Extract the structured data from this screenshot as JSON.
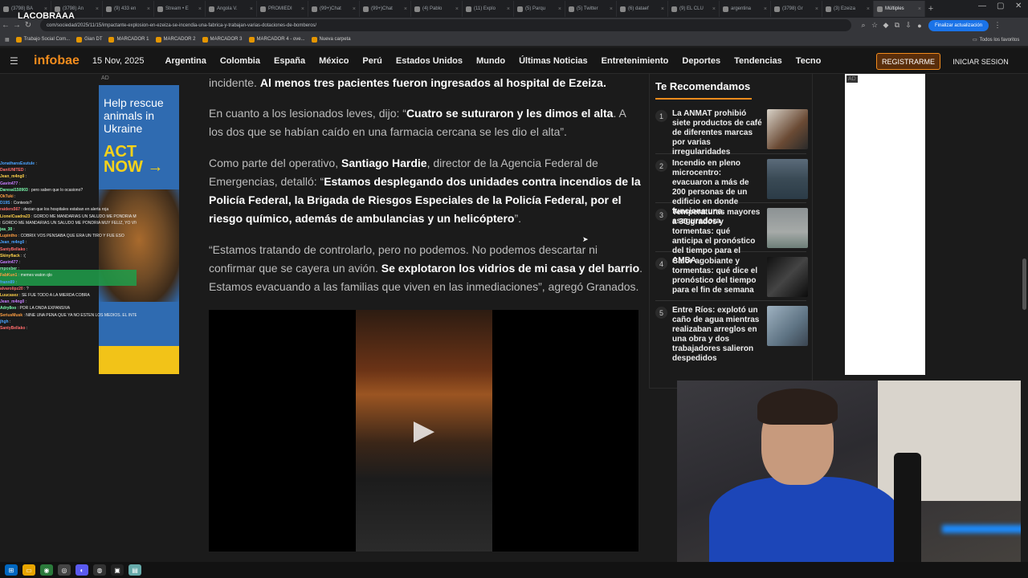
{
  "browser": {
    "tabs": [
      {
        "label": "(3798) BA"
      },
      {
        "label": "(3798) An"
      },
      {
        "label": "(9) 433 en"
      },
      {
        "label": "Stream • E"
      },
      {
        "label": "Angola V."
      },
      {
        "label": "PROMIEDI"
      },
      {
        "label": "(99+)Chat"
      },
      {
        "label": "(99+)Chat"
      },
      {
        "label": "(4) Pablo"
      },
      {
        "label": "(11) Explo"
      },
      {
        "label": "(5) Parqu"
      },
      {
        "label": "(5) Twitter"
      },
      {
        "label": "(6) dataef"
      },
      {
        "label": "(9) EL CLU"
      },
      {
        "label": "argentina"
      },
      {
        "label": "(3798) Gr"
      },
      {
        "label": "(3) Ezeiza"
      },
      {
        "label": "Múltiples"
      }
    ],
    "url": "com/sociedad/2025/11/15/impactante-explosion-en-ezeiza-se-incendia-una-fabrica-y-trabajan-varias-dotaciones-de-bomberos/",
    "update_label": "Finalizar actualización",
    "bookmarks": [
      "Trabajo Social Com...",
      "Gian DT",
      "MARCADOR 1",
      "MARCADOR 2",
      "MARCADOR 3",
      "MARCADOR 4 - ove...",
      "Nueva carpeta"
    ],
    "bookmarks_right": "Todos los favoritos"
  },
  "overlay": {
    "logo": "LACOBRAAA"
  },
  "site": {
    "logo": "infobae",
    "date": "15 Nov, 2025",
    "nav": [
      "Argentina",
      "Colombia",
      "España",
      "México",
      "Perú",
      "Estados Unidos",
      "Mundo",
      "Últimas Noticias",
      "Entretenimiento",
      "Deportes",
      "Tendencias",
      "Tecno"
    ],
    "register": "REGISTRARME",
    "login": "INICIAR SESION"
  },
  "ad_left": {
    "label": "AD",
    "line1": "Help rescue animals in Ukraine",
    "line2": "ACT NOW →"
  },
  "ad_right": {
    "label": "AD"
  },
  "article": {
    "p1_pre": "incidente. ",
    "p1_bold": "Al menos tres pacientes fueron ingresados al hospital de Ezeiza.",
    "p2_pre": "En cuanto a los lesionados leves, dijo: “",
    "p2_bold": "Cuatro se suturaron y les dimos el alta",
    "p2_post": ". A los dos que se habían caído en una farmacia cercana se les dio el alta”.",
    "p3_pre": "Como parte del operativo, ",
    "p3_bold1": "Santiago Hardie",
    "p3_mid": ", director de la Agencia Federal de Emergencias, detalló: “",
    "p3_bold2": "Estamos desplegando dos unidades contra incendios de la Policía Federal, la Brigada de Riesgos Especiales de la Policía Federal, por el riesgo químico, además de ambulancias y un helicóptero",
    "p3_post": "”.",
    "p4_pre": "“Estamos tratando de controlarlo, pero no podemos. No podemos descartar ni confirmar que se cayera un avión. ",
    "p4_bold": "Se explotaron los vidrios de mi casa y del barrio",
    "p4_post": ". Estamos evacuando a las familias que viven en las inmediaciones”, agregó Granados."
  },
  "recommend": {
    "title": "Te Recomendamos",
    "items": [
      {
        "num": "1",
        "text": "La ANMAT prohibió siete productos de café de diferentes marcas por varias irregularidades"
      },
      {
        "num": "2",
        "text": "Incendio en pleno microcentro: evacuaron a más de 200 personas de un edificio en donde funciona una aseguradora"
      },
      {
        "num": "3",
        "text": "Temperaturas mayores a 30 grados y tormentas: qué anticipa el pronóstico del tiempo para el AMBA"
      },
      {
        "num": "4",
        "text": "Calor agobiante y tormentas: qué dice el pronóstico del tiempo para el fin de semana"
      },
      {
        "num": "5",
        "text": "Entre Ríos: explotó un caño de agua mientras realizaban arreglos en una obra y dos trabajadores salieron despedidos"
      }
    ]
  },
  "chat": [
    {
      "user": "JonathansEsutule",
      "msg": ""
    },
    {
      "user": "DaniUNITED",
      "msg": ""
    },
    {
      "user": "Jean_m4ng0",
      "msg": ""
    },
    {
      "user": "Gavin477",
      "msg": ""
    },
    {
      "user": "Daresal150903",
      "msg": "pero saben que lo ocasiono?"
    },
    {
      "user": "OkTuki",
      "msg": ""
    },
    {
      "user": "D19S",
      "msg": "Contexto?"
    },
    {
      "user": "raiders567",
      "msg": "decian que los hospitales estaban en alerta roja"
    },
    {
      "user": "LionelCuadra23",
      "msg": "GORDO ME MANDARIAS UN SALUDO ME PONDRIA MUY FELIZ, YO VIVO EN SAN VICENTE Y TENGO MIEDO"
    },
    {
      "user": "",
      "msg": "GORDO ME MANDARIAS UN SALUDO ME PONDRIA MUY FELIZ, YO VIVO EN SAN VICENTE Y TENGO MIEDO"
    },
    {
      "user": "jea_30",
      "msg": ""
    },
    {
      "user": "Lupintho",
      "msg": "COBRIX VOS PENSABA QUE ERA UN TIRO Y FUE ESO"
    },
    {
      "user": "Jean_m4ng0",
      "msg": ""
    },
    {
      "user": "SantyBellako",
      "msg": ""
    },
    {
      "user": "Skinyflack",
      "msg": ":("
    },
    {
      "user": "Gavin477",
      "msg": ""
    },
    {
      "user": "mposber",
      "msg": ""
    },
    {
      "user": "FabKun1",
      "msg": "memes waton qlo"
    },
    {
      "user": "frann89",
      "msg": ""
    },
    {
      "user": "alvarolipz20",
      "msg": "?"
    },
    {
      "user": "Luucasez",
      "msg": "SE FUE TODO A LA MIERDA COBRA"
    },
    {
      "user": "Jean_m4ng0",
      "msg": ""
    },
    {
      "user": "Adry8oo",
      "msg": "POR LA ONDA EXPANSIVA"
    },
    {
      "user": "SeriusMusk",
      "msg": "NINE UNA PENA QUE YA NO ESTEN LOS MEDIOS. EL INTENDENTE LOS RAJO A TODOS"
    },
    {
      "user": "jhgh",
      "msg": ""
    },
    {
      "user": "SantyBellako",
      "msg": ""
    }
  ],
  "colors": {
    "accent": "#f28c1d",
    "page_bg": "#1b1b1b",
    "header_bg": "#161616"
  }
}
